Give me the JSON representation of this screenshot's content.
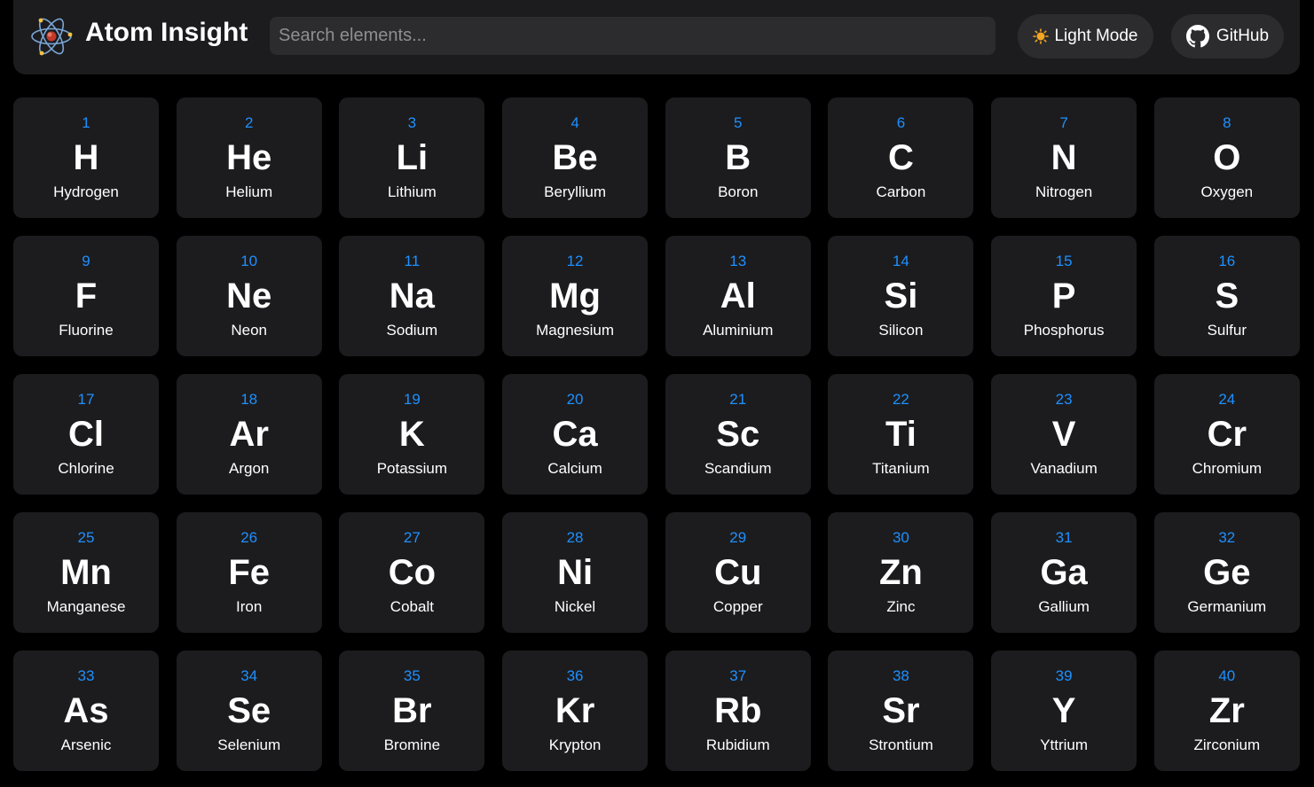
{
  "header": {
    "title": "Atom Insight",
    "logo_icon": "atom-icon",
    "search": {
      "placeholder": "Search elements...",
      "value": ""
    },
    "theme_button": {
      "label": "Light Mode",
      "icon": "sun-icon"
    },
    "github_button": {
      "label": "GitHub",
      "icon": "github-icon"
    }
  },
  "colors": {
    "background": "#000000",
    "surface": "#1c1c1e",
    "input": "#2c2c2e",
    "accent": "#1e90ff",
    "sun": "#f5a623"
  },
  "elements": [
    {
      "number": "1",
      "symbol": "H",
      "name": "Hydrogen"
    },
    {
      "number": "2",
      "symbol": "He",
      "name": "Helium"
    },
    {
      "number": "3",
      "symbol": "Li",
      "name": "Lithium"
    },
    {
      "number": "4",
      "symbol": "Be",
      "name": "Beryllium"
    },
    {
      "number": "5",
      "symbol": "B",
      "name": "Boron"
    },
    {
      "number": "6",
      "symbol": "C",
      "name": "Carbon"
    },
    {
      "number": "7",
      "symbol": "N",
      "name": "Nitrogen"
    },
    {
      "number": "8",
      "symbol": "O",
      "name": "Oxygen"
    },
    {
      "number": "9",
      "symbol": "F",
      "name": "Fluorine"
    },
    {
      "number": "10",
      "symbol": "Ne",
      "name": "Neon"
    },
    {
      "number": "11",
      "symbol": "Na",
      "name": "Sodium"
    },
    {
      "number": "12",
      "symbol": "Mg",
      "name": "Magnesium"
    },
    {
      "number": "13",
      "symbol": "Al",
      "name": "Aluminium"
    },
    {
      "number": "14",
      "symbol": "Si",
      "name": "Silicon"
    },
    {
      "number": "15",
      "symbol": "P",
      "name": "Phosphorus"
    },
    {
      "number": "16",
      "symbol": "S",
      "name": "Sulfur"
    },
    {
      "number": "17",
      "symbol": "Cl",
      "name": "Chlorine"
    },
    {
      "number": "18",
      "symbol": "Ar",
      "name": "Argon"
    },
    {
      "number": "19",
      "symbol": "K",
      "name": "Potassium"
    },
    {
      "number": "20",
      "symbol": "Ca",
      "name": "Calcium"
    },
    {
      "number": "21",
      "symbol": "Sc",
      "name": "Scandium"
    },
    {
      "number": "22",
      "symbol": "Ti",
      "name": "Titanium"
    },
    {
      "number": "23",
      "symbol": "V",
      "name": "Vanadium"
    },
    {
      "number": "24",
      "symbol": "Cr",
      "name": "Chromium"
    },
    {
      "number": "25",
      "symbol": "Mn",
      "name": "Manganese"
    },
    {
      "number": "26",
      "symbol": "Fe",
      "name": "Iron"
    },
    {
      "number": "27",
      "symbol": "Co",
      "name": "Cobalt"
    },
    {
      "number": "28",
      "symbol": "Ni",
      "name": "Nickel"
    },
    {
      "number": "29",
      "symbol": "Cu",
      "name": "Copper"
    },
    {
      "number": "30",
      "symbol": "Zn",
      "name": "Zinc"
    },
    {
      "number": "31",
      "symbol": "Ga",
      "name": "Gallium"
    },
    {
      "number": "32",
      "symbol": "Ge",
      "name": "Germanium"
    },
    {
      "number": "33",
      "symbol": "As",
      "name": "Arsenic"
    },
    {
      "number": "34",
      "symbol": "Se",
      "name": "Selenium"
    },
    {
      "number": "35",
      "symbol": "Br",
      "name": "Bromine"
    },
    {
      "number": "36",
      "symbol": "Kr",
      "name": "Krypton"
    },
    {
      "number": "37",
      "symbol": "Rb",
      "name": "Rubidium"
    },
    {
      "number": "38",
      "symbol": "Sr",
      "name": "Strontium"
    },
    {
      "number": "39",
      "symbol": "Y",
      "name": "Yttrium"
    },
    {
      "number": "40",
      "symbol": "Zr",
      "name": "Zirconium"
    }
  ]
}
